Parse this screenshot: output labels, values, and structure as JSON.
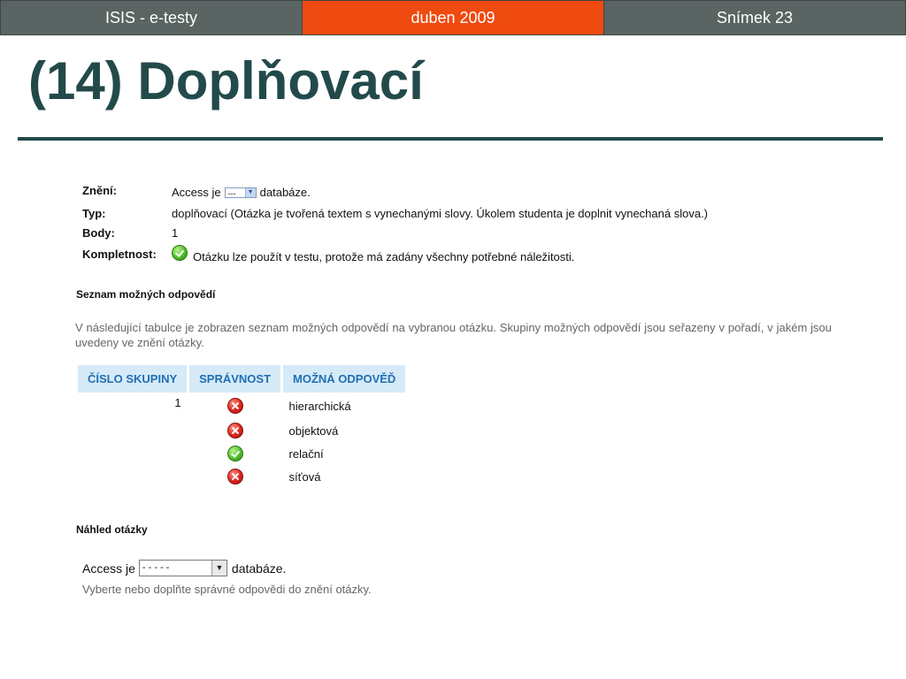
{
  "header": {
    "left": "ISIS - e-testy",
    "center": "duben 2009",
    "right": "Snímek 23"
  },
  "title": "(14) Doplňovací",
  "question": {
    "zneni_label": "Znění:",
    "zneni_before": "Access je",
    "zneni_select": "---",
    "zneni_after": "databáze.",
    "typ_label": "Typ:",
    "typ_value": "doplňovací (Otázka je tvořená textem s vynechanými slovy. Úkolem studenta je doplnit vynechaná slova.)",
    "body_label": "Body:",
    "body_value": "1",
    "kompletnost_label": "Kompletnost:",
    "kompletnost_value": "Otázku lze použít v testu, protože má zadány všechny potřebné náležitosti."
  },
  "answers_section": {
    "heading": "Seznam možných odpovědí",
    "description": "V následující tabulce je zobrazen seznam možných odpovědí na vybranou otázku. Skupiny možných odpovědí jsou seřazeny v pořadí, v jakém jsou uvedeny ve znění otázky.",
    "columns": [
      "ČÍSLO SKUPINY",
      "SPRÁVNOST",
      "MOŽNÁ ODPOVĚĎ"
    ],
    "group": "1",
    "rows": [
      {
        "answer": "hierarchická",
        "correct": false
      },
      {
        "answer": "objektová",
        "correct": false
      },
      {
        "answer": "relační",
        "correct": true
      },
      {
        "answer": "síťová",
        "correct": false
      }
    ]
  },
  "preview_section": {
    "heading": "Náhled otázky",
    "before": "Access je",
    "select_value": "- - - - -",
    "after": "databáze.",
    "hint": "Vyberte nebo doplňte správné odpovědi do znění otázky."
  },
  "colors": {
    "header_gray": "#5a6462",
    "header_accent": "#ef4a10",
    "title": "#234a4a",
    "table_header_bg": "#d6eaf8",
    "table_header_text": "#1f6fb2"
  }
}
